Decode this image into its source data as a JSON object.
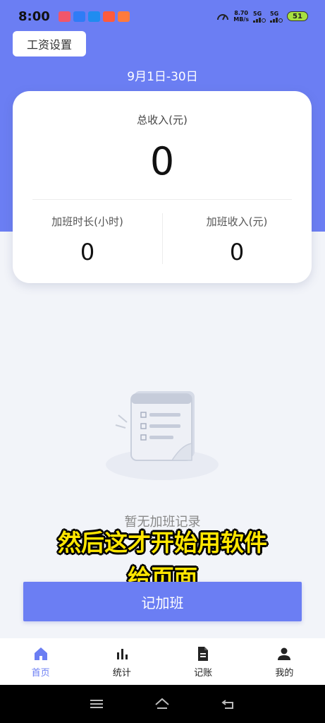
{
  "status_bar": {
    "time": "8:00",
    "net_speed_value": "8.70",
    "net_speed_unit": "MB/s",
    "signal1": "5G",
    "signal2": "5G",
    "battery": "51"
  },
  "header": {
    "settings_label": "工资设置",
    "date_range": "9月1日-30日"
  },
  "summary": {
    "total_label": "总收入(元)",
    "total_value": "0",
    "overtime_hours_label": "加班时长(小时)",
    "overtime_hours_value": "0",
    "overtime_income_label": "加班收入(元)",
    "overtime_income_value": "0"
  },
  "empty_state": {
    "text": "暂无加班记录"
  },
  "subtitle": {
    "line1": "然后这才开始用软件",
    "line2": "给页面"
  },
  "actions": {
    "record_overtime": "记加班"
  },
  "tabs": [
    {
      "label": "首页",
      "icon": "home-icon",
      "active": true
    },
    {
      "label": "统计",
      "icon": "bar-chart-icon",
      "active": false
    },
    {
      "label": "记账",
      "icon": "document-icon",
      "active": false
    },
    {
      "label": "我的",
      "icon": "person-icon",
      "active": false
    }
  ],
  "colors": {
    "accent": "#6b7ef3",
    "subtitle": "#ffe600"
  }
}
